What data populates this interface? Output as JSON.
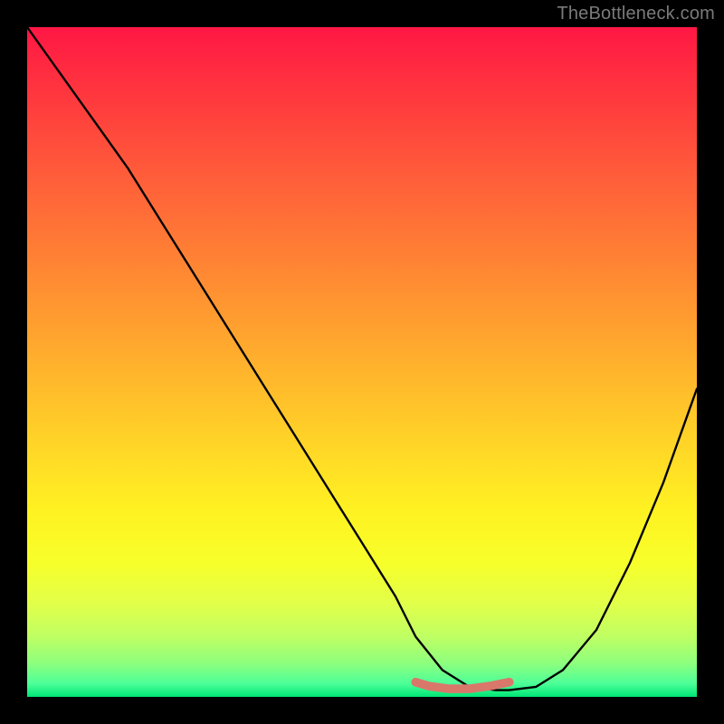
{
  "watermark": "TheBottleneck.com",
  "chart_data": {
    "type": "line",
    "title": "",
    "xlabel": "",
    "ylabel": "",
    "xlim": [
      0,
      100
    ],
    "ylim": [
      0,
      100
    ],
    "series": [
      {
        "name": "curve",
        "color": "#000000",
        "x": [
          0,
          5,
          10,
          15,
          20,
          25,
          30,
          35,
          40,
          45,
          50,
          55,
          58,
          62,
          66,
          70,
          72,
          76,
          80,
          85,
          90,
          95,
          100
        ],
        "y": [
          100,
          93,
          86,
          79,
          71,
          63,
          55,
          47,
          39,
          31,
          23,
          15,
          9,
          4,
          1.5,
          1,
          1,
          1.5,
          4,
          10,
          20,
          32,
          46
        ]
      },
      {
        "name": "highlight",
        "color": "#d9776b",
        "x": [
          58,
          60,
          63,
          66,
          69,
          72
        ],
        "y": [
          2.2,
          1.6,
          1.2,
          1.2,
          1.6,
          2.2
        ]
      }
    ]
  }
}
